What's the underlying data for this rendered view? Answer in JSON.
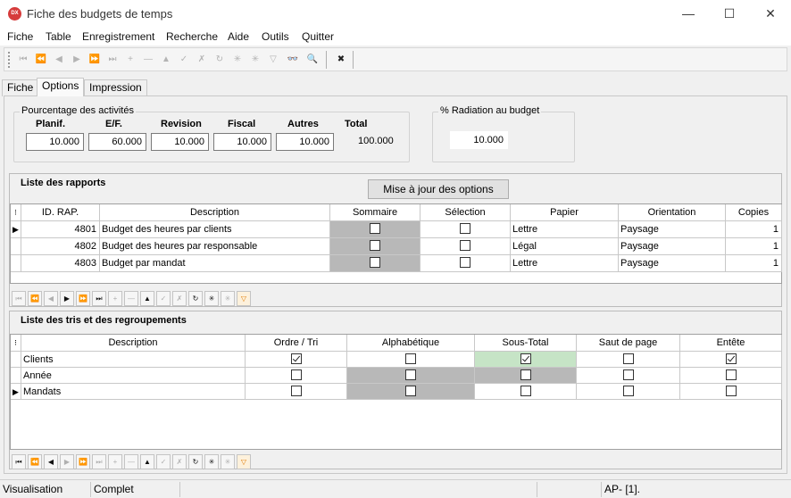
{
  "window": {
    "title": "Fiche des budgets de temps",
    "icon_text": "DX",
    "minimize": "—",
    "maximize": "☐",
    "close": "✕"
  },
  "menu": [
    "Fiche",
    "Table",
    "Enregistrement",
    "Recherche",
    "Aide",
    "Outils",
    "Quitter"
  ],
  "toolbar": {
    "icons": [
      "first-icon",
      "prev-page-icon",
      "prev-icon",
      "next-icon",
      "next-page-icon",
      "last-icon",
      "insert-icon",
      "delete-icon",
      "edit-icon",
      "post-icon",
      "cancel-icon",
      "refresh-icon",
      "new-icon",
      "copy-icon",
      "filter-icon",
      "binoculars-icon",
      "search-icon",
      "close-icon"
    ],
    "glyphs": [
      "⏮",
      "⏪",
      "◀",
      "▶",
      "⏩",
      "⏭",
      "+",
      "—",
      "▲",
      "✓",
      "✗",
      "↻",
      "✳",
      "✳",
      "▽",
      "👓",
      "🔍",
      "✖"
    ]
  },
  "tabs": [
    "Fiche",
    "Options",
    "Impression"
  ],
  "active_tab": 1,
  "activities": {
    "title": "Pourcentage des activités",
    "columns": [
      {
        "label": "Planif.",
        "value": "10.000"
      },
      {
        "label": "E/F.",
        "value": "60.000"
      },
      {
        "label": "Revision",
        "value": "10.000"
      },
      {
        "label": "Fiscal",
        "value": "10.000"
      },
      {
        "label": "Autres",
        "value": "10.000"
      }
    ],
    "total_label": "Total",
    "total_value": "100.000"
  },
  "radiation": {
    "title": "% Radiation au budget",
    "value": "10.000"
  },
  "reports": {
    "title": "Liste des rapports",
    "update_button": "Mise à jour des options",
    "indicator_glyph": "⁝",
    "row_marker": "▶",
    "columns": [
      "ID. RAP.",
      "Description",
      "Sommaire",
      "Sélection",
      "Papier",
      "Orientation",
      "Copies"
    ],
    "rows": [
      {
        "id": "4801",
        "description": "Budget des heures par clients",
        "sommaire": false,
        "selection": false,
        "papier": "Lettre",
        "orientation": "Paysage",
        "copies": "1"
      },
      {
        "id": "4802",
        "description": "Budget des heures par responsable",
        "sommaire": false,
        "selection": false,
        "papier": "Légal",
        "orientation": "Paysage",
        "copies": "1"
      },
      {
        "id": "4803",
        "description": "Budget par mandat",
        "sommaire": false,
        "selection": false,
        "papier": "Lettre",
        "orientation": "Paysage",
        "copies": "1"
      }
    ]
  },
  "sorts": {
    "title": "Liste des tris et des regroupements",
    "indicator_glyph": "⁝",
    "row_marker": "▶",
    "columns": [
      "Description",
      "Ordre / Tri",
      "Alphabétique",
      "Sous-Total",
      "Saut de page",
      "Entête"
    ],
    "rows": [
      {
        "description": "Clients",
        "ordre": true,
        "alpha": false,
        "sous_total": true,
        "saut": false,
        "entete": true
      },
      {
        "description": "Année",
        "ordre": false,
        "alpha": false,
        "sous_total": false,
        "saut": false,
        "entete": false
      },
      {
        "description": "Mandats",
        "ordre": false,
        "alpha": false,
        "sous_total": false,
        "saut": false,
        "entete": false
      }
    ]
  },
  "navigator": {
    "icons": [
      "first-icon",
      "prev-page-icon",
      "prev-icon",
      "next-icon",
      "next-page-icon",
      "last-icon",
      "insert-icon",
      "delete-icon",
      "edit-icon",
      "post-icon",
      "cancel-icon",
      "refresh-icon",
      "new-icon",
      "copy-icon",
      "filter-icon"
    ],
    "glyphs": [
      "⏮",
      "⏪",
      "◀",
      "▶",
      "⏩",
      "⏭",
      "+",
      "—",
      "▲",
      "✓",
      "✗",
      "↻",
      "✳",
      "✳",
      "▽"
    ]
  },
  "status": {
    "mode": "Visualisation",
    "state": "Complet",
    "info": "AP- [1]."
  }
}
